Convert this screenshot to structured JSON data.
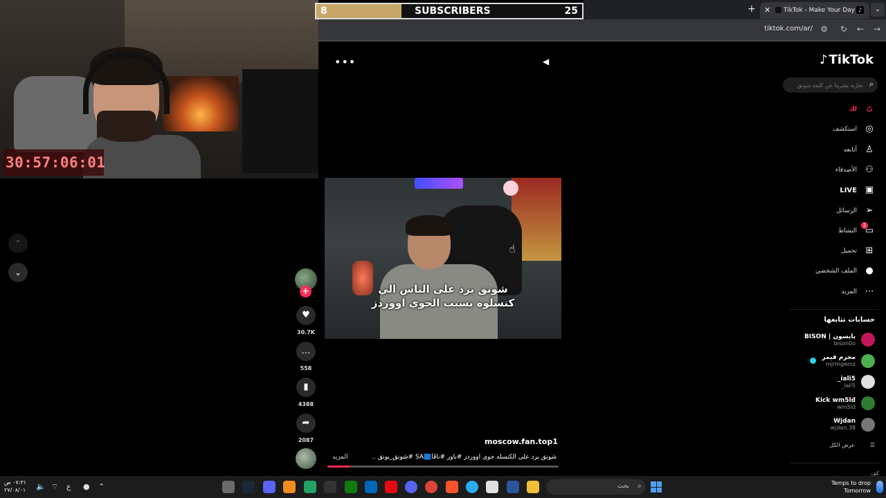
{
  "stream": {
    "timer": "30:57:06:01",
    "subscribers": {
      "current": "8",
      "label": "SUBSCRIBERS",
      "goal": "25",
      "progress": 0.32
    }
  },
  "browser": {
    "tab_title": "TikTok - Make Your Day",
    "url": "tiktok.com/ar/",
    "new_tab": "+",
    "close_tab": "✕"
  },
  "tiktok": {
    "logo": "TikTok",
    "search": {
      "placeholder": "تحرّبة بشريتا عن كلمة شوتق"
    },
    "nav": [
      {
        "label": "لك",
        "icon": "home-icon",
        "active": true
      },
      {
        "label": "استكشف",
        "icon": "compass-icon",
        "active": false
      },
      {
        "label": "أتابعه",
        "icon": "following-icon",
        "active": false
      },
      {
        "label": "الأصدقاء",
        "icon": "friends-icon",
        "active": false
      },
      {
        "label": "LIVE",
        "icon": "live-icon",
        "active": false
      },
      {
        "label": "الرسائل",
        "icon": "messages-icon",
        "active": false
      },
      {
        "label": "النشاط",
        "icon": "activity-icon",
        "active": false,
        "badge": "1"
      },
      {
        "label": "تحميل",
        "icon": "upload-icon",
        "active": false
      },
      {
        "label": "الملف الشخصي",
        "icon": "profile-icon",
        "active": false
      },
      {
        "label": "المزيد",
        "icon": "more-icon",
        "active": false
      }
    ],
    "following_title": "حسابات تتابعها",
    "following": [
      {
        "name": "BISON | بايسون",
        "handle": "bison0o",
        "color": "#c2185b"
      },
      {
        "name": "مجرم قيمز",
        "handle": "mjrmgemz",
        "color": "#4caf50",
        "verified": true
      },
      {
        "name": "_iali5",
        "handle": "_iali5",
        "color": "#e0e0e0"
      },
      {
        "name": "Kick wm5ld",
        "handle": "wm5ld",
        "color": "#2e7d32"
      },
      {
        "name": "Wjdan",
        "handle": "wjdan.38",
        "color": "#777777"
      }
    ],
    "see_all": "عرض الكل",
    "cut_text": "كف كة",
    "video": {
      "caption_line1": "شونق يرد على الناس الي",
      "caption_line2": "كنسلوه بسبب الجوي اووردز",
      "author": "moscow.fan.top1",
      "description": "شونق يرد على الكنسله جوى اووردز #باور #ناقًا🟦SA #شونق_يونق ...",
      "more": "المزيد",
      "likes": "30.7K",
      "comments": "558",
      "saves": "4388",
      "shares": "2087",
      "progress": 0.1
    }
  },
  "taskbar": {
    "time": "٠٧:٣١ ص",
    "date": "٢٧/٠٨/٠١",
    "lang": "ع",
    "search_label": "بحث",
    "weather_line1": "Temps to drop",
    "weather_line2": "Tomorrow"
  }
}
